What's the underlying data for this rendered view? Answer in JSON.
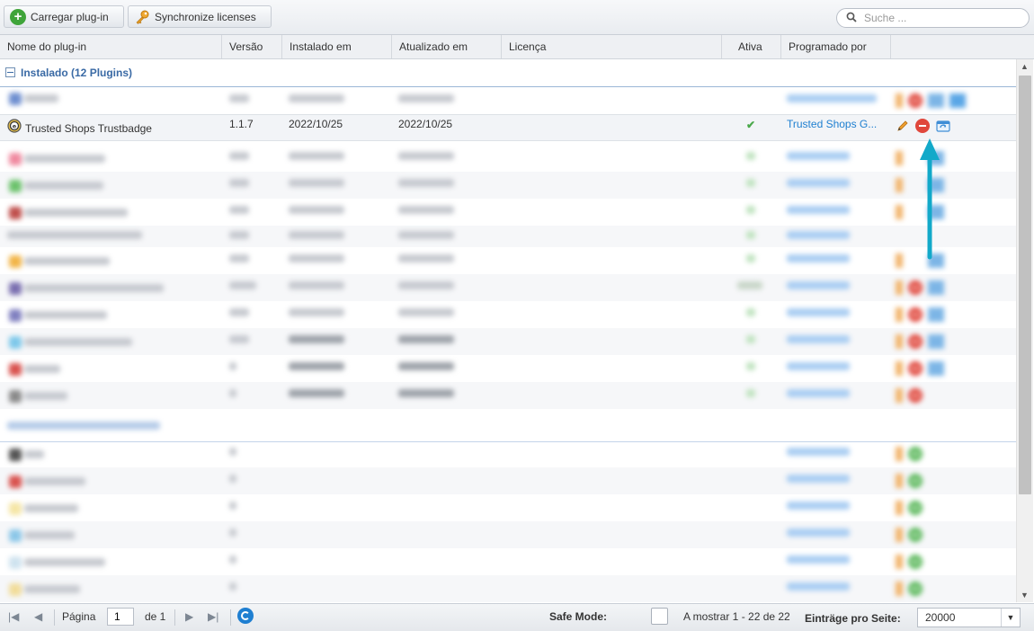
{
  "toolbar": {
    "upload_label": "Carregar plug-in",
    "sync_label": "Synchronize licenses",
    "search_placeholder": "Suche ..."
  },
  "columns": [
    "Nome do plug-in",
    "Versão",
    "Instalado em",
    "Atualizado em",
    "Licença",
    "Ativa",
    "Programado por"
  ],
  "group_installed": "Instalado (12 Plugins)",
  "selected_row": {
    "name": "Trusted Shops Trustbadge",
    "version": "1.1.7",
    "installed": "2022/10/25",
    "updated": "2022/10/25",
    "active_mark": "✔",
    "author": "Trusted Shops G..."
  },
  "footer": {
    "page_label": "Página",
    "page_value": "1",
    "of_label": "de 1",
    "safe_mode_label": "Safe Mode:",
    "showing_label": "A mostrar 1 - 22 de 22",
    "entries_label": "Einträge pro Seite:",
    "entries_value": "20000"
  },
  "colors": {
    "accent": "#1e7fd0",
    "annotation_arrow": "#12a9c9",
    "active_green": "#4aa84a",
    "delete_red": "#e0473c"
  }
}
